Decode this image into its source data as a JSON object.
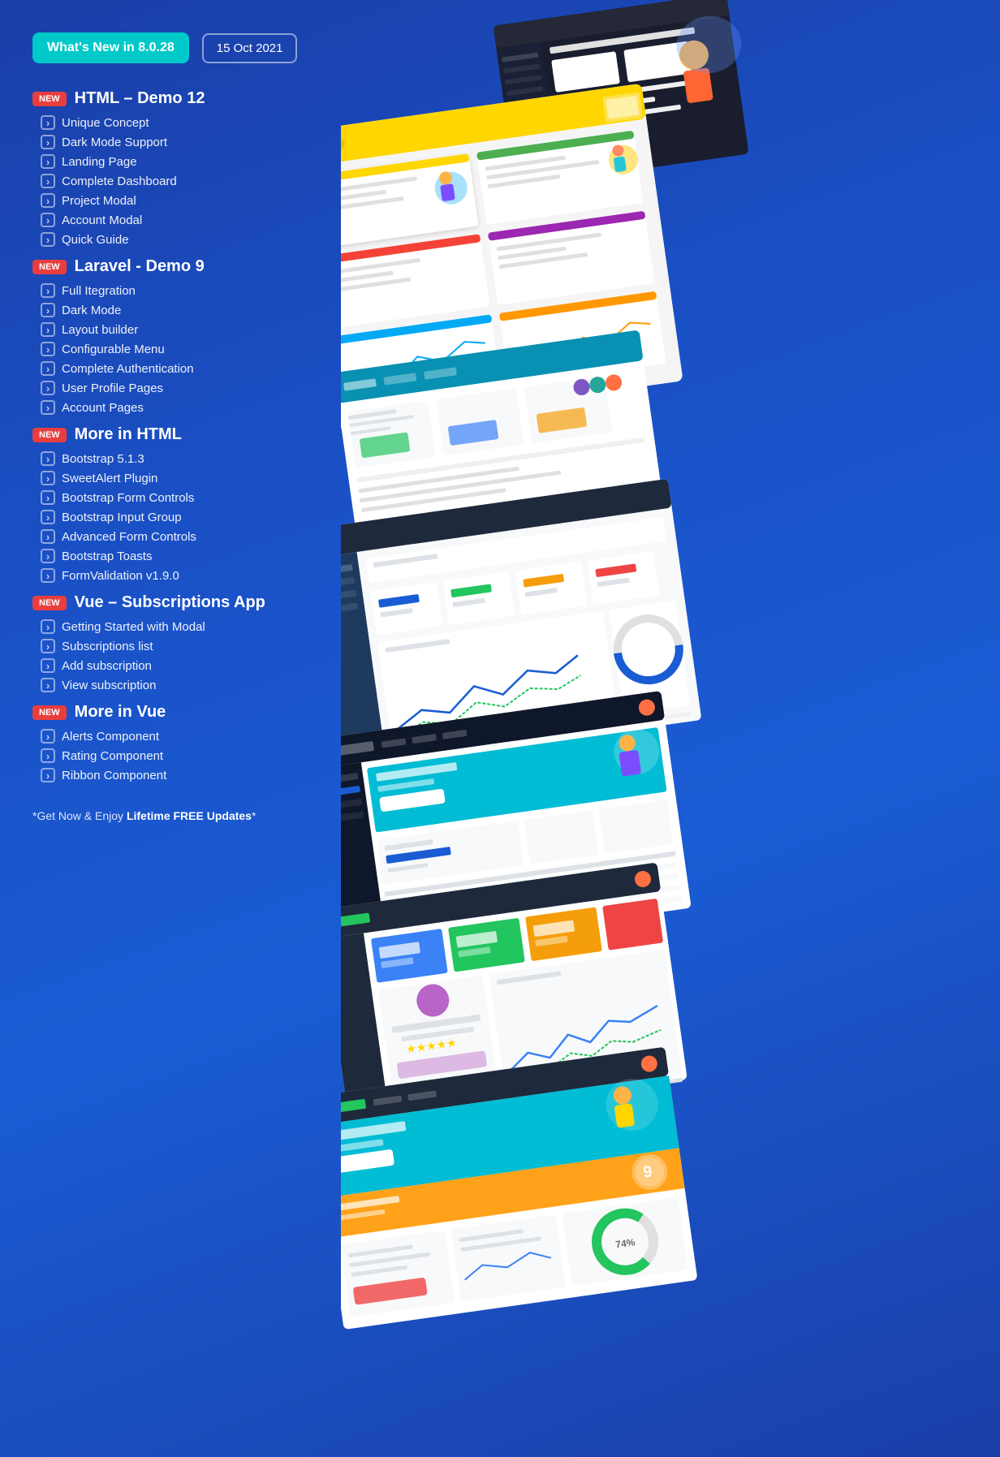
{
  "header": {
    "badge_text": "What's New in 8.0.28",
    "date_text": "15 Oct 2021"
  },
  "sections": [
    {
      "id": "html-demo",
      "is_new": true,
      "title": "HTML – Demo 12",
      "items": [
        "Unique Concept",
        "Dark Mode Support",
        "Landing Page",
        "Complete Dashboard",
        "Project Modal",
        "Account Modal",
        "Quick Guide"
      ]
    },
    {
      "id": "laravel-demo",
      "is_new": true,
      "title": "Laravel - Demo 9",
      "items": [
        "Full Itegration",
        "Dark Mode",
        "Layout builder",
        "Configurable Menu",
        "Complete Authentication",
        "User Profile Pages",
        "Account Pages"
      ]
    },
    {
      "id": "more-html",
      "is_new": true,
      "title": "More in HTML",
      "items": [
        "Bootstrap 5.1.3",
        "SweetAlert Plugin",
        "Bootstrap Form Controls",
        "Bootstrap Input Group",
        "Advanced Form Controls",
        "Bootstrap Toasts",
        "FormValidation v1.9.0"
      ]
    },
    {
      "id": "vue-subscriptions",
      "is_new": true,
      "title": "Vue – Subscriptions App",
      "items": [
        "Getting Started with Modal",
        "Subscriptions list",
        "Add subscription",
        "View subscription"
      ]
    },
    {
      "id": "more-vue",
      "is_new": true,
      "title": "More in Vue",
      "items": [
        "Alerts Component",
        "Rating Component",
        "Ribbon Component"
      ]
    }
  ],
  "footer": {
    "text_prefix": "*Get Now & Enjoy ",
    "text_bold": "Lifetime FREE Updates",
    "text_suffix": "*"
  },
  "badges": {
    "new_label": "New"
  }
}
